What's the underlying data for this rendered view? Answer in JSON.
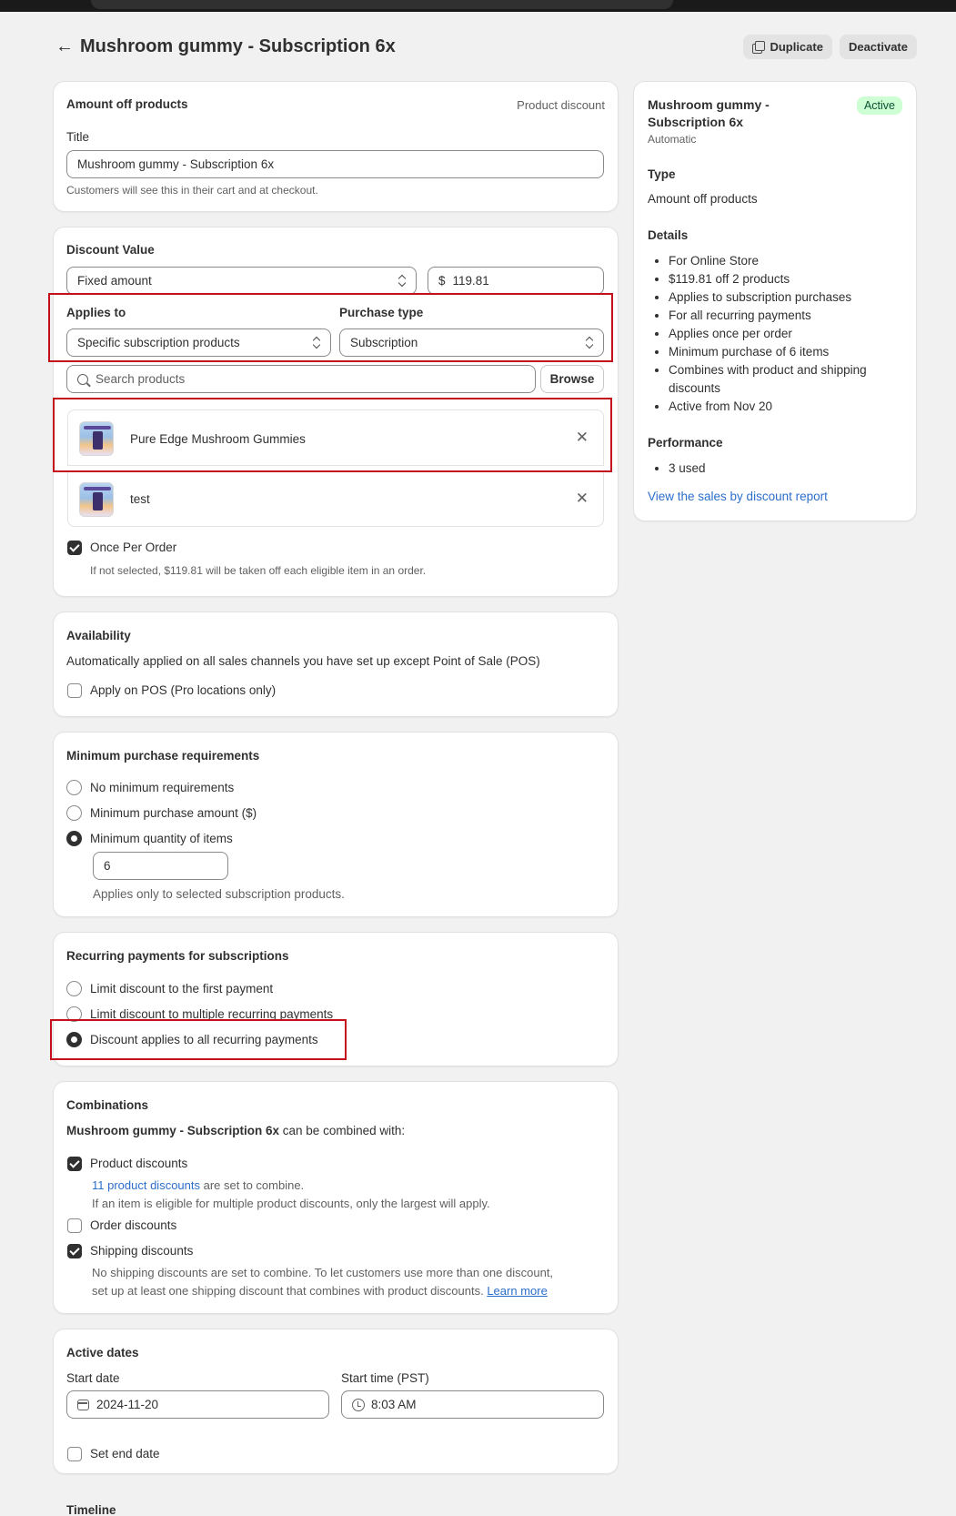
{
  "header": {
    "title": "Mushroom gummy - Subscription 6x",
    "duplicate_label": "Duplicate",
    "deactivate_label": "Deactivate"
  },
  "amount_card": {
    "heading": "Amount off products",
    "kind": "Product discount",
    "title_label": "Title",
    "title_value": "Mushroom gummy - Subscription 6x",
    "help": "Customers will see this in their cart and at checkout."
  },
  "value_card": {
    "heading": "Discount Value",
    "type_value": "Fixed amount",
    "currency": "$",
    "amount": "119.81",
    "applies_label": "Applies to",
    "applies_value": "Specific subscription products",
    "purchase_label": "Purchase type",
    "purchase_value": "Subscription",
    "search_placeholder": "Search products",
    "browse_label": "Browse",
    "products": [
      {
        "name": "Pure Edge Mushroom Gummies"
      },
      {
        "name": "test"
      }
    ],
    "once_label": "Once Per Order",
    "once_checked": true,
    "once_help": "If not selected, $119.81 will be taken off each eligible item in an order."
  },
  "availability": {
    "heading": "Availability",
    "desc": "Automatically applied on all sales channels you have set up except Point of Sale (POS)",
    "pos_label": "Apply on POS (Pro locations only)"
  },
  "minimum": {
    "heading": "Minimum purchase requirements",
    "options": [
      "No minimum requirements",
      "Minimum purchase amount ($)",
      "Minimum quantity of items"
    ],
    "selected": "Minimum quantity of items",
    "quantity": "6",
    "help": "Applies only to selected subscription products."
  },
  "recurring": {
    "heading": "Recurring payments for subscriptions",
    "options": [
      "Limit discount to the first payment",
      "Limit discount to multiple recurring payments",
      "Discount applies to all recurring payments"
    ],
    "selected": "Discount applies to all recurring payments"
  },
  "combinations": {
    "heading": "Combinations",
    "name_bold": "Mushroom gummy - Subscription 6x",
    "name_suffix": " can be combined with:",
    "product_label": "Product discounts",
    "product_link": "11 product discounts",
    "product_link_suffix": " are set to combine.",
    "product_help": "If an item is eligible for multiple product discounts, only the largest will apply.",
    "order_label": "Order discounts",
    "shipping_label": "Shipping discounts",
    "shipping_help_1": "No shipping discounts are set to combine. To let customers use more than one discount,",
    "shipping_help_2": "set up at least one shipping discount that combines with product discounts.",
    "learn_more": "Learn more"
  },
  "dates": {
    "heading": "Active dates",
    "start_date_label": "Start date",
    "start_date": "2024-11-20",
    "start_time_label": "Start time (PST)",
    "start_time": "8:03 AM",
    "end_label": "Set end date"
  },
  "timeline": {
    "heading": "Timeline"
  },
  "summary": {
    "title": "Mushroom gummy - Subscription 6x",
    "status": "Active",
    "method": "Automatic",
    "type_heading": "Type",
    "type_value": "Amount off products",
    "details_heading": "Details",
    "details": [
      "For Online Store",
      "$119.81 off 2 products",
      "Applies to subscription purchases",
      "For all recurring payments",
      "Applies once per order",
      "Minimum purchase of 6 items",
      "Combines with product and shipping discounts",
      "Active from Nov 20"
    ],
    "performance_heading": "Performance",
    "performance": [
      "3 used"
    ],
    "report_link": "View the sales by discount report"
  },
  "colors": {
    "highlight": "#c4101a",
    "active_badge_bg": "#cdfed4",
    "link": "#2c6ecb"
  }
}
